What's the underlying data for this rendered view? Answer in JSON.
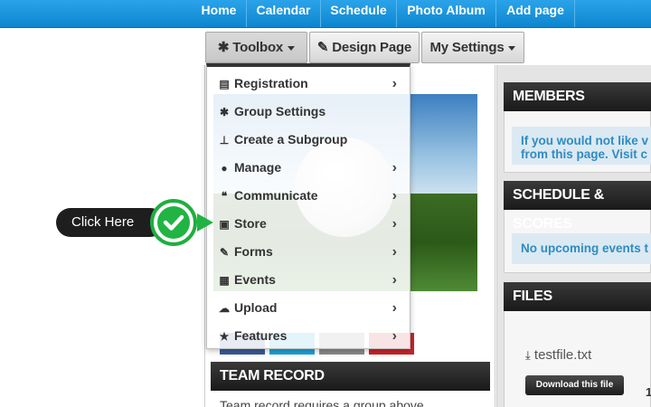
{
  "topnav": {
    "items": [
      {
        "label": "Home"
      },
      {
        "label": "Calendar"
      },
      {
        "label": "Schedule"
      },
      {
        "label": "Photo Album"
      },
      {
        "label": "Add page"
      }
    ]
  },
  "toolbar": {
    "toolbox_label": "Toolbox",
    "design_label": "Design Page",
    "settings_label": "My Settings"
  },
  "dropdown": {
    "items": [
      {
        "label": "Registration",
        "icon": "list-icon",
        "glyph": "▤",
        "submenu": true
      },
      {
        "label": "Group Settings",
        "icon": "gear-icon",
        "glyph": "✱",
        "submenu": false
      },
      {
        "label": "Create a Subgroup",
        "icon": "sitemap-icon",
        "glyph": "⊥",
        "submenu": false
      },
      {
        "label": "Manage",
        "icon": "users-icon",
        "glyph": "●",
        "submenu": true
      },
      {
        "label": "Communicate",
        "icon": "comments-icon",
        "glyph": "❝",
        "submenu": true
      },
      {
        "label": "Store",
        "icon": "money-icon",
        "glyph": "▣",
        "submenu": true
      },
      {
        "label": "Forms",
        "icon": "edit-icon",
        "glyph": "✎",
        "submenu": true
      },
      {
        "label": "Events",
        "icon": "calendar-icon",
        "glyph": "▦",
        "submenu": true
      },
      {
        "label": "Upload",
        "icon": "cloud-upload-icon",
        "glyph": "☁",
        "submenu": true
      },
      {
        "label": "Features",
        "icon": "star-icon",
        "glyph": "★",
        "submenu": true
      }
    ],
    "chevron": "›"
  },
  "callout": {
    "label": "Click Here"
  },
  "members": {
    "title": "MEMBERS",
    "text_line1": "If you would not like v",
    "text_line2": "from this page. Visit c"
  },
  "schedule": {
    "title": "SCHEDULE & SCORES",
    "text": "No upcoming events t"
  },
  "files": {
    "title": "FILES",
    "filename": "testfile.txt",
    "download_label": "Download this file",
    "count": "1"
  },
  "team_record": {
    "title": "TEAM RECORD",
    "text": "Team record requires a group above"
  },
  "colors": {
    "nav": "#1893dc",
    "accent": "#21b443",
    "link": "#2f8cc2",
    "header": "#222222"
  }
}
